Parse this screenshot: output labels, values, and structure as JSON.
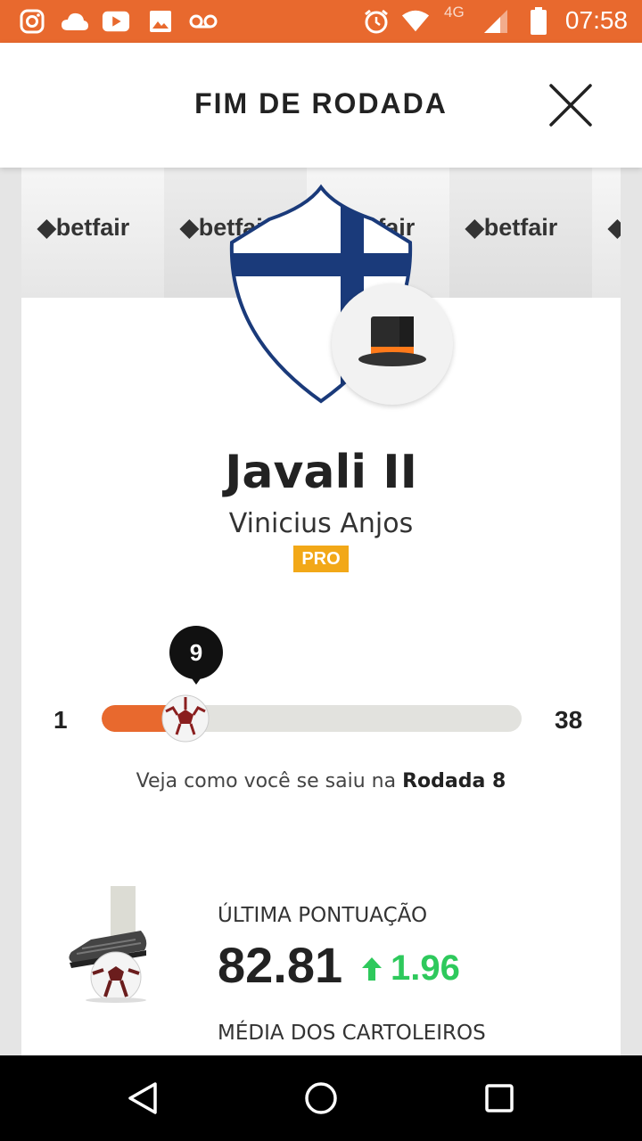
{
  "status_bar": {
    "time": "07:58",
    "network": "4G"
  },
  "header": {
    "title": "FIM DE RODADA"
  },
  "ads": {
    "label": "betfair"
  },
  "team": {
    "name": "Javali II",
    "owner": "Vinicius Anjos",
    "badge": "PRO"
  },
  "rounds": {
    "current": "9",
    "min": "1",
    "max": "38",
    "progress": 0.2
  },
  "round_caption": {
    "prefix": "Veja como você se saiu na ",
    "bold": "Rodada 8"
  },
  "stats": {
    "last_score_label": "ÚLTIMA PONTUAÇÃO",
    "last_score_value": "82.81",
    "last_score_delta": "1.96",
    "average_label": "MÉDIA DOS CARTOLEIROS"
  },
  "colors": {
    "accent": "#e8692e",
    "positive": "#2ec95c",
    "badge": "#f2a818",
    "shield": "#1a3a7a"
  }
}
